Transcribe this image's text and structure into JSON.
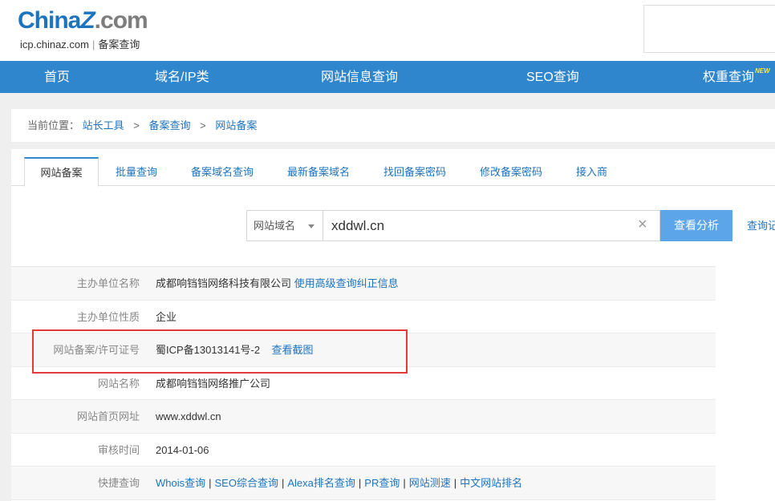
{
  "logo": {
    "part1": "China",
    "part2": "Z",
    "part3": ".com",
    "domain": "icp.chinaz.com",
    "divider": "|",
    "subtitle": "备案查询"
  },
  "nav": {
    "items": [
      "首页",
      "域名/IP类",
      "网站信息查询",
      "SEO查询",
      "权重查询"
    ],
    "new_badge": "NEW"
  },
  "breadcrumb": {
    "label": "当前位置：",
    "items": [
      "站长工具",
      "备案查询",
      "网站备案"
    ],
    "separator": ">"
  },
  "tabs": [
    "网站备案",
    "批量查询",
    "备案域名查询",
    "最新备案域名",
    "找回备案密码",
    "修改备案密码",
    "接入商"
  ],
  "search": {
    "select_value": "网站域名",
    "input_value": "xddwl.cn",
    "clear_symbol": "×",
    "button_label": "查看分析",
    "more_link": "查询记"
  },
  "results": [
    {
      "key": "主办单位名称",
      "value": "成都响铛铛网络科技有限公司",
      "link": "使用高级查询纠正信息"
    },
    {
      "key": "主办单位性质",
      "value": "企业"
    },
    {
      "key": "网站备案/许可证号",
      "value": "蜀ICP备13013141号-2",
      "link": "查看截图"
    },
    {
      "key": "网站名称",
      "value": "成都响铛铛网络推广公司"
    },
    {
      "key": "网站首页网址",
      "value": "www.xddwl.cn"
    },
    {
      "key": "审核时间",
      "value": "2014-01-06"
    },
    {
      "key": "快捷查询",
      "links": [
        "Whois查询",
        "SEO综合查询",
        "Alexa排名查询",
        "PR查询",
        "网站测速",
        "中文网站排名"
      ],
      "separator": "|"
    }
  ],
  "colors": {
    "nav_bg": "#2f86cd",
    "link": "#1e73be",
    "button": "#5ba5e8",
    "highlight": "#e03a3a"
  }
}
